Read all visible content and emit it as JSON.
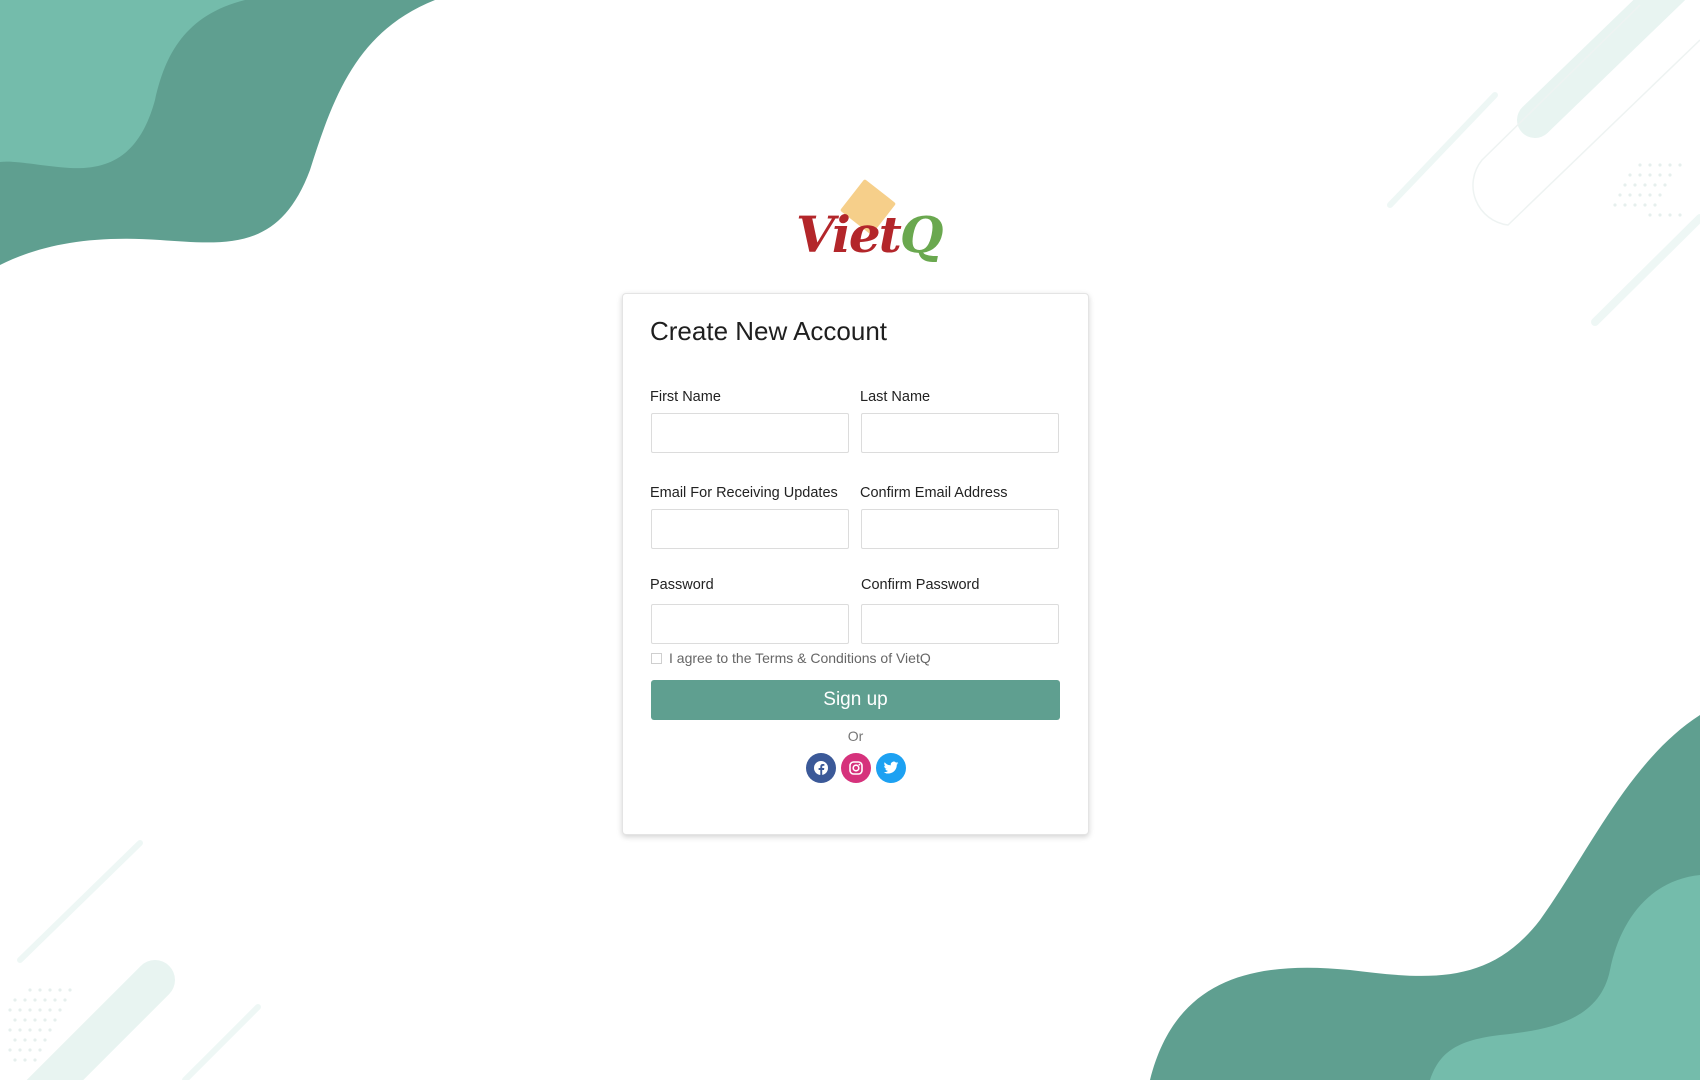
{
  "brand": {
    "logo_text": "Viet",
    "logo_text_q": "Q"
  },
  "form": {
    "title": "Create New Account",
    "first_name_label": "First Name",
    "last_name_label": "Last Name",
    "email_label": "Email For Receiving Updates",
    "confirm_email_label": "Confirm Email Address",
    "password_label": "Password",
    "confirm_password_label": "Confirm Password",
    "terms_text": "I agree to the Terms & Conditions of VietQ",
    "terms_checked": false,
    "signup_label": "Sign up",
    "or_text": "Or"
  },
  "social": [
    {
      "icon": "facebook-icon",
      "color": "#3b5998"
    },
    {
      "icon": "instagram-icon",
      "color": "#d6327c"
    },
    {
      "icon": "twitter-icon",
      "color": "#1da1f2"
    }
  ],
  "colors": {
    "accent": "#5f9f90",
    "wave_dark": "#5f9f90",
    "wave_light": "#74bcab",
    "decor": "#e8f4f1"
  }
}
